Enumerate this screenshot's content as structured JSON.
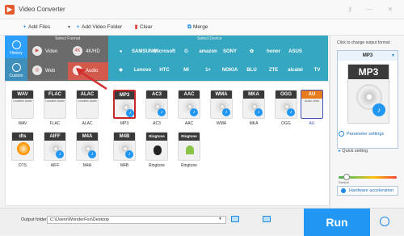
{
  "window": {
    "title": "Video Converter"
  },
  "toolbar": {
    "add_files": "Add Files",
    "add_video_folder": "Add Video Folder",
    "clear": "Clear",
    "merge": "Merge"
  },
  "nav": {
    "history": "History",
    "custom": "Custom"
  },
  "format_section": {
    "label": "Select Format",
    "video": "Video",
    "hd": "4K/HD",
    "web": "Web",
    "audio": "Audio"
  },
  "device_section": {
    "label": "Select Device",
    "brands": [
      "",
      "SAMSUNG",
      "Microsoft",
      "G",
      "amazon",
      "SONY",
      "",
      "honor",
      "ASUS",
      "",
      "Lenovo",
      "HTC",
      "MI",
      "1+",
      "NOKIA",
      "BLU",
      "ZTE",
      "alcatel",
      "TV"
    ]
  },
  "formats": [
    {
      "head": "WAV",
      "sub": "Lossless Audio",
      "label": "WAV"
    },
    {
      "head": "FLAC",
      "sub": "Lossless Audio",
      "label": "FLAC"
    },
    {
      "head": "ALAC",
      "sub": "Lossless Audio",
      "label": "ALAC"
    },
    {
      "head": "MP3",
      "sub": "",
      "label": "MP3"
    },
    {
      "head": "AC3",
      "sub": "",
      "label": "AC3"
    },
    {
      "head": "AAC",
      "sub": "",
      "label": "AAC"
    },
    {
      "head": "WMA",
      "sub": "",
      "label": "WMA"
    },
    {
      "head": "MKA",
      "sub": "",
      "label": "MKA"
    },
    {
      "head": "OGG",
      "sub": "",
      "label": "OGG"
    },
    {
      "head": "AU",
      "sub": "Audio Units",
      "label": "AU"
    },
    {
      "head": "dts",
      "sub": "",
      "label": "DTS"
    },
    {
      "head": "AIFF",
      "sub": "",
      "label": "AIFF"
    },
    {
      "head": "M4A",
      "sub": "",
      "label": "M4A"
    },
    {
      "head": "M4B",
      "sub": "",
      "label": "M4B"
    },
    {
      "head": "Ringtone",
      "sub": "",
      "label": "Ringtone"
    },
    {
      "head": "Ringtone",
      "sub": "",
      "label": "Ringtone"
    }
  ],
  "output": {
    "label": "Output folder:",
    "path": "C:\\Users\\WonderFox\\Desktop"
  },
  "run": {
    "label": "Run"
  },
  "right_panel": {
    "hint": "Click to change output format:",
    "format": "MP3",
    "format_tile": "MP3",
    "parameter_settings": "Parameter settings",
    "quick_setting": "Quick setting",
    "slider_default": "Default",
    "hardware_acceleration": "Hardware acceleration"
  }
}
